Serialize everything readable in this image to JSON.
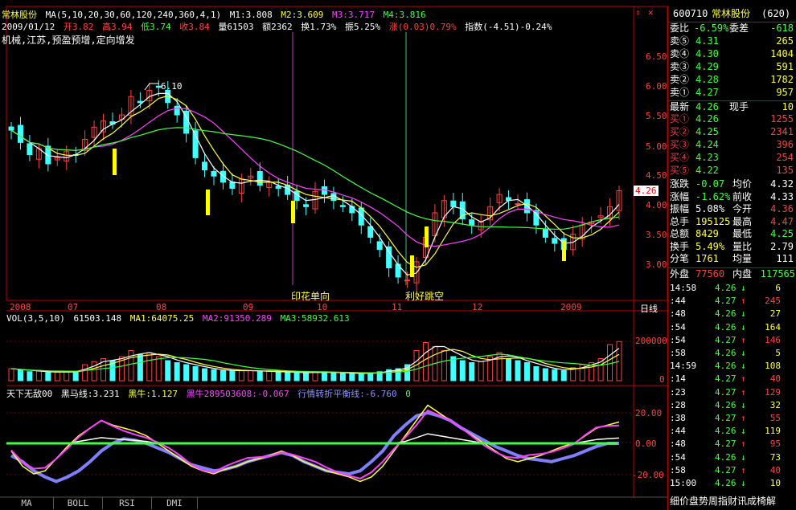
{
  "header": {
    "stock_name": "常林股份",
    "ma_params": "MA(5,10,20,30,60,120,240,360,4,1)",
    "m1": "M1:3.808",
    "m2": "M2:3.609",
    "m3": "M3:3.717",
    "m4": "M4:3.816",
    "date": "2009/01/12",
    "open": "开3.82",
    "high": "高3.94",
    "low": "低3.74",
    "close": "收3.84",
    "volume": "量61503",
    "amount": "额2362",
    "turnover": "换1.73%",
    "amplitude": "振5.25%",
    "change": "涨(0.03)0.79%",
    "index": "指数(-4.51)-0.24%",
    "tags": "机械,江苏,预盈预增,定向增发",
    "icon_colors": {
      "up": "#ff4040",
      "down": "#40ff40"
    }
  },
  "price_axis": [
    "6.50",
    "6.00",
    "5.50",
    "5.00",
    "4.50",
    "4.00",
    "3.50",
    "3.00"
  ],
  "current_price_tag": "4.26",
  "annotations": {
    "peak_label": "6.10",
    "event1": "印花单向",
    "event2": "利好跳空"
  },
  "date_axis": [
    "2008",
    "07",
    "08",
    "09",
    "10",
    "11",
    "12",
    "2009"
  ],
  "period_label": "日线",
  "vol_header": {
    "title": "VOL(3,5,10)",
    "value": "61503.148",
    "ma1": "MA1:64075.25",
    "ma2": "MA2:91350.289",
    "ma3": "MA3:58932.613"
  },
  "vol_axis": [
    "200000",
    "0"
  ],
  "ind_header": {
    "name": "天下无敌00",
    "black_horse": "黑马线:3.231",
    "black_bull": "黑牛:1.127",
    "black_bull2": "黑牛289503608:-0.067",
    "balance": "行情转折平衡线:-6.760",
    "last": "0"
  },
  "ind_axis": [
    "20.00",
    "0.00",
    "-20.00"
  ],
  "bottom_tabs": [
    "MA",
    "BOLL",
    "RSI",
    "DMI"
  ],
  "right_panel": {
    "code": "600710",
    "name": "常林股份",
    "num": "(620)",
    "weibi_label": "委比",
    "weibi": "-6.59%",
    "weicha_label": "委差",
    "weicha": "-618",
    "asks": [
      {
        "label": "卖⑤",
        "price": "4.31",
        "vol": "265"
      },
      {
        "label": "卖④",
        "price": "4.30",
        "vol": "1404"
      },
      {
        "label": "卖③",
        "price": "4.29",
        "vol": "591"
      },
      {
        "label": "卖②",
        "price": "4.28",
        "vol": "1782"
      },
      {
        "label": "卖①",
        "price": "4.27",
        "vol": "957"
      }
    ],
    "latest_label": "最新",
    "latest": "4.26",
    "xianshou_label": "现手",
    "xianshou": "10",
    "bids": [
      {
        "label": "买①",
        "price": "4.26",
        "vol": "1255"
      },
      {
        "label": "买②",
        "price": "4.25",
        "vol": "2341"
      },
      {
        "label": "买③",
        "price": "4.24",
        "vol": "396"
      },
      {
        "label": "买④",
        "price": "4.23",
        "vol": "254"
      },
      {
        "label": "买⑤",
        "price": "4.22",
        "vol": "135"
      }
    ],
    "stats": [
      {
        "l1": "涨跌",
        "v1": "-0.07",
        "l2": "均价",
        "v2": "4.32"
      },
      {
        "l1": "涨幅",
        "v1": "-1.62%",
        "l2": "前收",
        "v2": "4.33"
      },
      {
        "l1": "振幅",
        "v1": "5.08%",
        "l2": "今开",
        "v2": "4.36"
      },
      {
        "l1": "总手",
        "v1": "195125",
        "l2": "最高",
        "v2": "4.47"
      },
      {
        "l1": "总额",
        "v1": "8429",
        "l2": "最低",
        "v2": "4.25"
      },
      {
        "l1": "换手",
        "v1": "5.49%",
        "l2": "量比",
        "v2": "2.79"
      },
      {
        "l1": "分笔",
        "v1": "1761",
        "l2": "均量",
        "v2": "111"
      }
    ],
    "waipan_label": "外盘",
    "waipan": "77560",
    "neipan_label": "内盘",
    "neipan": "117565",
    "ticks": [
      {
        "t": "14:58",
        "p": "4.26",
        "d": "↓",
        "v": "6"
      },
      {
        "t": ":44",
        "p": "4.27",
        "d": "↑",
        "v": "245"
      },
      {
        "t": ":48",
        "p": "4.26",
        "d": "↓",
        "v": "27"
      },
      {
        "t": ":54",
        "p": "4.26",
        "d": "↓",
        "v": "164"
      },
      {
        "t": ":54",
        "p": "4.27",
        "d": "↑",
        "v": "146"
      },
      {
        "t": ":58",
        "p": "4.26",
        "d": "↓",
        "v": "5"
      },
      {
        "t": "14:59",
        "p": "4.26",
        "d": "↓",
        "v": "108"
      },
      {
        "t": ":14",
        "p": "4.27",
        "d": "↑",
        "v": "40"
      },
      {
        "t": ":23",
        "p": "4.27",
        "d": "↑",
        "v": "129"
      },
      {
        "t": ":28",
        "p": "4.26",
        "d": "↓",
        "v": "32"
      },
      {
        "t": ":38",
        "p": "4.27",
        "d": "↑",
        "v": "55"
      },
      {
        "t": ":44",
        "p": "4.26",
        "d": "↓",
        "v": "119"
      },
      {
        "t": ":48",
        "p": "4.27",
        "d": "↑",
        "v": "95"
      },
      {
        "t": ":54",
        "p": "4.26",
        "d": "↓",
        "v": "73"
      },
      {
        "t": ":58",
        "p": "4.27",
        "d": "↑",
        "v": "40"
      },
      {
        "t": "15:00",
        "p": "4.26",
        "d": "↓",
        "v": "10"
      }
    ],
    "footer": "细价盘势周指财讯成椅解"
  },
  "chart_data": {
    "type": "candlestick",
    "price_range": [
      2.6,
      6.8
    ],
    "dates": [
      "2008",
      "07",
      "08",
      "09",
      "10",
      "11",
      "12",
      "2009"
    ],
    "close": [
      5.25,
      5.05,
      4.85,
      4.95,
      4.7,
      4.8,
      4.9,
      4.85,
      5.1,
      5.3,
      5.4,
      5.35,
      5.5,
      5.8,
      5.7,
      5.9,
      5.95,
      5.7,
      5.5,
      5.2,
      4.8,
      4.6,
      4.5,
      4.4,
      4.3,
      4.45,
      4.5,
      4.35,
      4.4,
      4.3,
      4.2,
      4.1,
      4.0,
      4.25,
      4.2,
      4.1,
      4.0,
      3.9,
      3.7,
      3.5,
      3.3,
      3.0,
      2.85,
      2.8,
      3.1,
      3.5,
      3.9,
      4.1,
      4.0,
      3.8,
      3.7,
      3.75,
      4.0,
      4.2,
      4.1,
      4.05,
      3.9,
      3.7,
      3.5,
      3.4,
      3.3,
      3.55,
      3.7,
      3.75,
      3.85,
      4.0,
      4.26
    ],
    "volume": [
      60000,
      52000,
      45000,
      48000,
      40000,
      42000,
      46000,
      44000,
      80000,
      95000,
      110000,
      100000,
      120000,
      150000,
      130000,
      140000,
      120000,
      100000,
      90000,
      80000,
      70000,
      60000,
      55000,
      50000,
      48000,
      52000,
      50000,
      45000,
      46000,
      44000,
      42000,
      40000,
      38000,
      45000,
      42000,
      40000,
      38000,
      36000,
      34000,
      40000,
      45000,
      55000,
      60000,
      80000,
      150000,
      190000,
      170000,
      150000,
      120000,
      100000,
      90000,
      95000,
      120000,
      140000,
      110000,
      100000,
      90000,
      70000,
      60000,
      55000,
      50000,
      65000,
      80000,
      90000,
      110000,
      180000,
      195125
    ],
    "indicator": [
      -5,
      -15,
      -20,
      -18,
      -10,
      -2,
      5,
      10,
      15,
      12,
      10,
      8,
      5,
      0,
      -5,
      -10,
      -15,
      -18,
      -20,
      -17,
      -15,
      -12,
      -10,
      -8,
      -5,
      -8,
      -12,
      -15,
      -18,
      -20,
      -22,
      -25,
      -22,
      -15,
      -5,
      5,
      15,
      25,
      20,
      15,
      10,
      5,
      0,
      -5,
      -10,
      -12,
      -10,
      -8,
      -5,
      -2,
      0,
      5,
      10,
      12,
      14
    ],
    "balance": [
      -8,
      -12,
      -18,
      -22,
      -25,
      -22,
      -18,
      -12,
      -5,
      0,
      3,
      2,
      0,
      -3,
      -6,
      -10,
      -14,
      -16,
      -18,
      -17,
      -15,
      -12,
      -10,
      -8,
      -6,
      -8,
      -12,
      -15,
      -18,
      -19,
      -20,
      -18,
      -12,
      -5,
      5,
      12,
      18,
      20,
      18,
      15,
      10,
      6,
      2,
      -2,
      -5,
      -8,
      -10,
      -11,
      -12,
      -10,
      -8,
      -5,
      -2,
      0,
      0
    ]
  }
}
